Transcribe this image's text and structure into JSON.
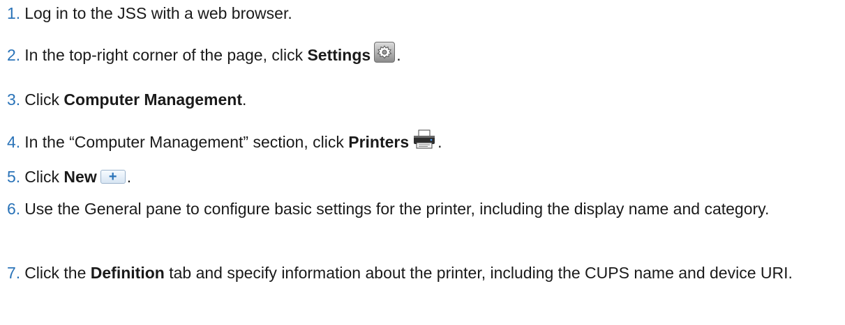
{
  "steps": [
    {
      "num": "1.",
      "text": "Log in to the JSS with a web browser."
    },
    {
      "num": "2.",
      "pre": "In the top-right corner of the page, click ",
      "bold": "Settings",
      "post": ".",
      "icon": "settings-gear-icon"
    },
    {
      "num": "3.",
      "pre": "Click ",
      "bold": "Computer Management",
      "post": "."
    },
    {
      "num": "4.",
      "pre": "In the “Computer Management” section, click ",
      "bold": "Printers",
      "post": ".",
      "icon": "printer-icon"
    },
    {
      "num": "5.",
      "pre": "Click ",
      "bold": "New",
      "post": ".",
      "icon": "new-plus-icon",
      "icon_glyph": "+"
    },
    {
      "num": "6.",
      "text": "Use the General pane to configure basic settings for the printer, including the display name and category."
    },
    {
      "num": "7.",
      "pre": "Click the ",
      "bold": "Definition",
      "post": " tab and specify information about the printer, including the CUPS name and device URI."
    }
  ],
  "colors": {
    "number": "#2a73b8",
    "text": "#1a1a1a"
  }
}
